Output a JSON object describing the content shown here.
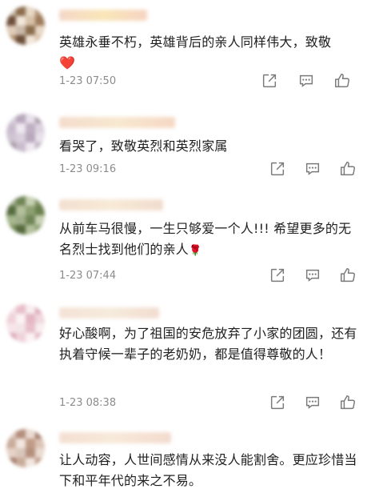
{
  "comments": [
    {
      "text": "英雄永垂不朽，英雄背后的亲人同样伟大，致敬",
      "emoji": "❤️",
      "time": "1-23 07:50",
      "avatar_colors": [
        "#c9b9a9",
        "#8a6d4c",
        "#e8d8c8",
        "#b09070",
        "#6d4f3a",
        "#f2e6da",
        "#d7c1a8",
        "#9e7b5b",
        "#e0cdb9"
      ]
    },
    {
      "text": "看哭了，致敬英烈和英烈家属",
      "time": "1-23 09:16",
      "avatar_colors": [
        "#d8d0dc",
        "#b8a8bc",
        "#e8e0ea",
        "#a89aa8",
        "#c9bccd",
        "#efe8f0",
        "#bfb0c3",
        "#ddd3df",
        "#cfc4d2"
      ]
    },
    {
      "text": "从前车马很慢，一生只够爱一个人!!! 希望更多的无名烈士找到他们的亲人",
      "emoji": "🌹",
      "time": "1-23 07:44",
      "avatar_colors": [
        "#9fae8a",
        "#6f8556",
        "#c8d1b4",
        "#7b8f5e",
        "#556b3e",
        "#b4c09c",
        "#8ca070",
        "#6a7f4d",
        "#a6b68e"
      ]
    },
    {
      "text": "好心酸啊，为了祖国的安危放弃了小家的团圆，还有执着守候一辈子的老奶奶，都是值得尊敬的人！",
      "time": "1-23 08:38",
      "avatar_colors": [
        "#f3e4e8",
        "#e8bfc9",
        "#f8eef0",
        "#dca8b6",
        "#efd2da",
        "#fbf3f5",
        "#e3b7c3",
        "#f0d8de",
        "#f6e6ea"
      ]
    },
    {
      "text": "让人动容，人世间感情从来没人能割舍。更应珍惜当下和平年代的来之不易。",
      "avatar_colors": [
        "#d9c6bb",
        "#b48f7c",
        "#eadbd2",
        "#a07866",
        "#c9ab9a",
        "#f2e7e0",
        "#bf9b88",
        "#dcc3b5",
        "#e6d3c8"
      ]
    }
  ],
  "icons": {
    "share": "share-icon",
    "reply": "comment-icon",
    "like": "thumbs-up-icon"
  },
  "colors": {
    "text": "#1f1f1f",
    "time": "#8c8c8c",
    "icon": "#7a7a7a"
  }
}
